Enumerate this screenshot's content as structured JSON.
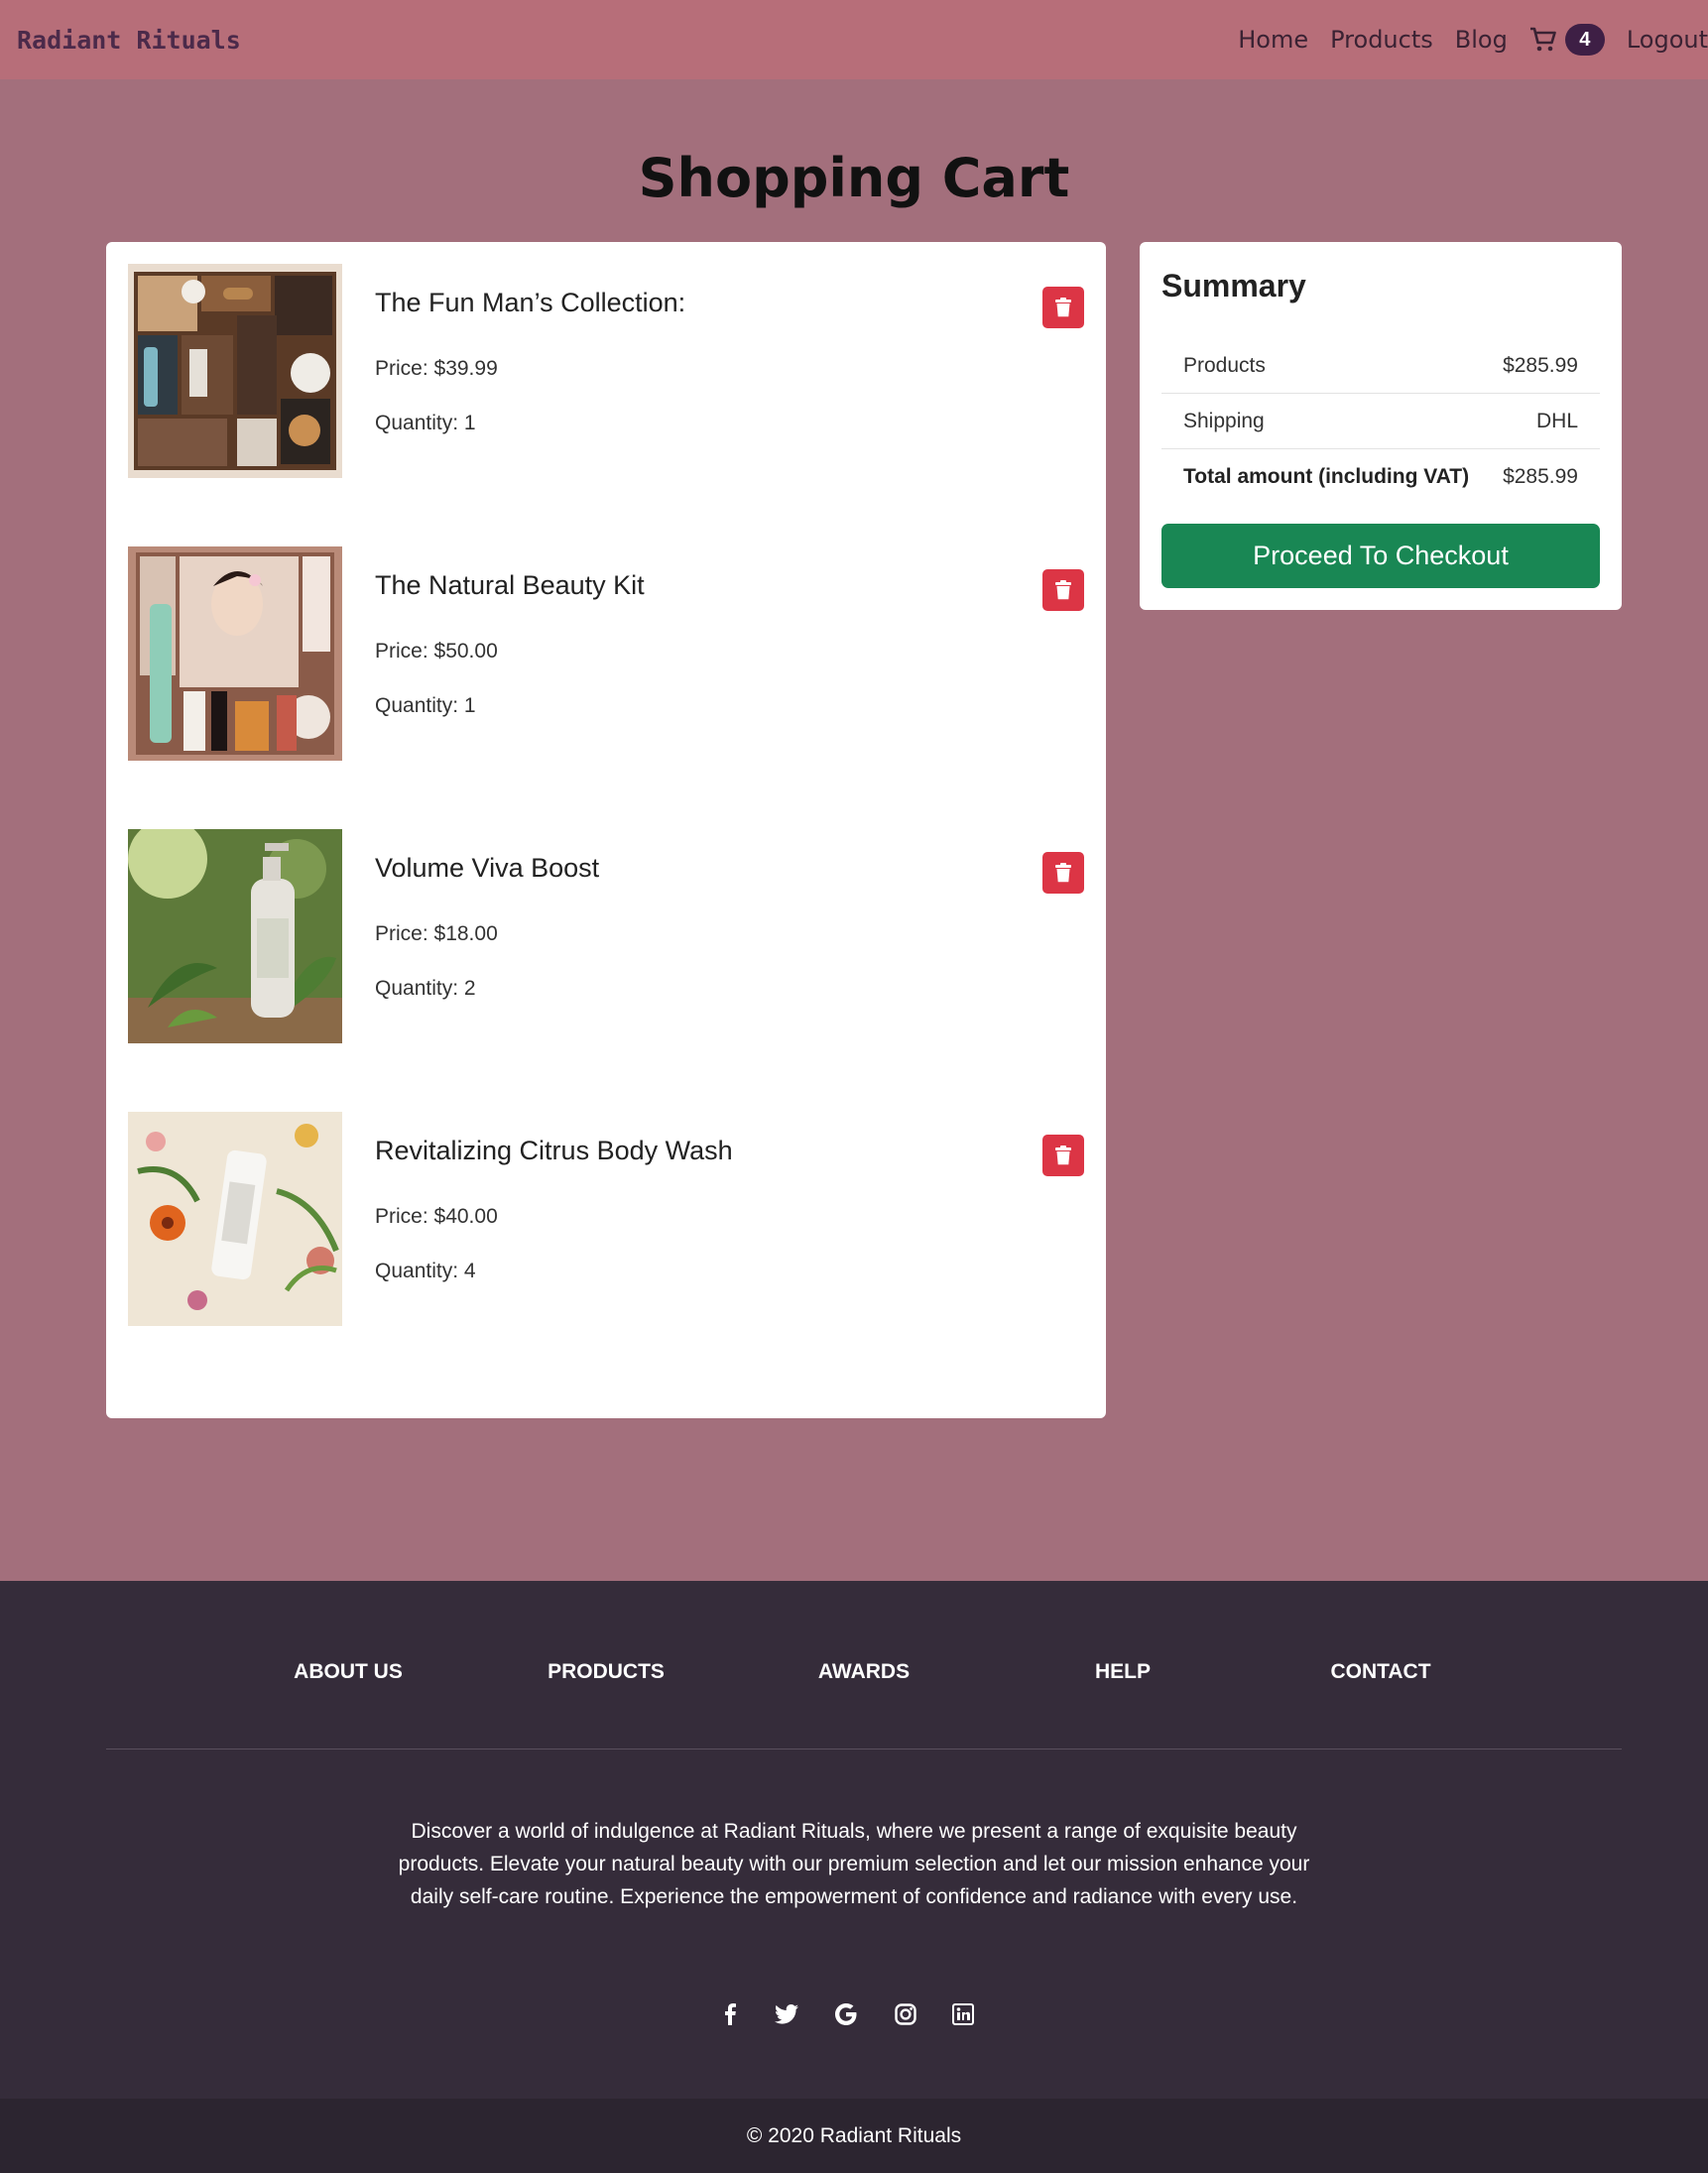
{
  "nav": {
    "brand": "Radiant Rituals",
    "links": [
      "Home",
      "Products",
      "Blog"
    ],
    "cart_count": "4",
    "logout": "Logout"
  },
  "page_title": "Shopping Cart",
  "cart_items": [
    {
      "name": "The Fun Man’s Collection:",
      "price": "Price: $39.99",
      "quantity": "Quantity: 1"
    },
    {
      "name": "The Natural Beauty Kit",
      "price": "Price: $50.00",
      "quantity": "Quantity: 1"
    },
    {
      "name": "Volume Viva Boost",
      "price": "Price: $18.00",
      "quantity": "Quantity: 2"
    },
    {
      "name": "Revitalizing Citrus Body Wash",
      "price": "Price: $40.00",
      "quantity": "Quantity: 4"
    }
  ],
  "summary": {
    "title": "Summary",
    "rows": [
      {
        "label": "Products",
        "value": "$285.99"
      },
      {
        "label": "Shipping",
        "value": "DHL"
      },
      {
        "label": "Total amount (including VAT)",
        "value": "$285.99"
      }
    ],
    "checkout_label": "Proceed To Checkout"
  },
  "footer": {
    "links": [
      "ABOUT US",
      "PRODUCTS",
      "AWARDS",
      "HELP",
      "CONTACT"
    ],
    "description": "Discover a world of indulgence at Radiant Rituals, where we present a range of exquisite beauty products. Elevate your natural beauty with our premium selection and let our mission enhance your daily self-care routine. Experience the empowerment of confidence and radiance with every use.",
    "socials": [
      "facebook-icon",
      "twitter-icon",
      "google-icon",
      "instagram-icon",
      "linkedin-icon"
    ],
    "copyright": "© 2020 Radiant Rituals"
  },
  "colors": {
    "navbar": "#b76e79",
    "page_bg": "#a36f7c",
    "delete": "#dc3545",
    "checkout": "#198754",
    "footer": "#352c3a",
    "badge": "#3e1f45"
  }
}
